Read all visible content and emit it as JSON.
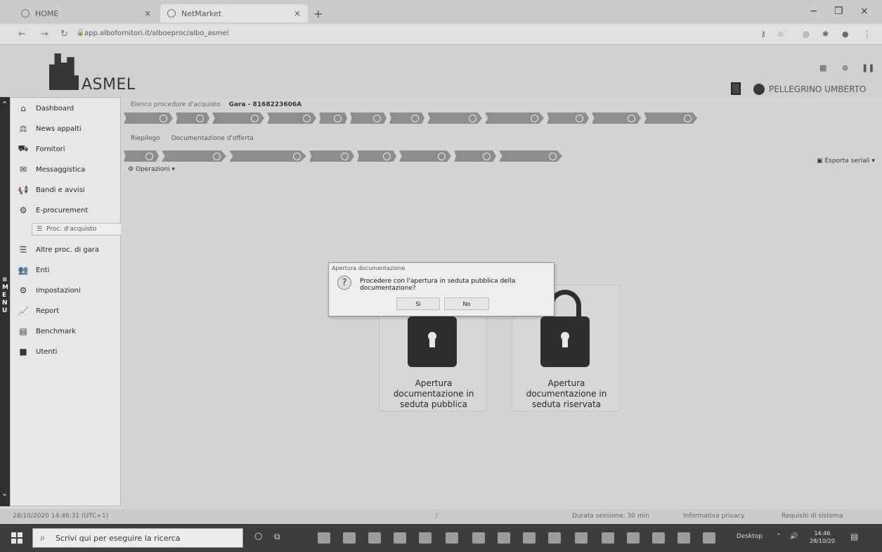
{
  "browser": {
    "tab1_title": "HOME",
    "tab2_title": "NetMarket",
    "close_glyph": "×",
    "new_tab_glyph": "+",
    "url": "app.albofornitori.it/alboeproc/albo_asmel",
    "minimize_glyph": "−",
    "maximize_glyph": "❐",
    "close_window_glyph": "×"
  },
  "header": {
    "logo_text": "ASMEL",
    "user_name": "PELLEGRINO UMBERTO"
  },
  "sidebar": {
    "items": [
      {
        "label": "Dashboard",
        "icon": "home-icon",
        "glyph": "⌂"
      },
      {
        "label": "News appalti",
        "icon": "scales-icon",
        "glyph": "⚖"
      },
      {
        "label": "Fornitori",
        "icon": "truck-icon",
        "glyph": "⛟"
      },
      {
        "label": "Messaggistica",
        "icon": "message-icon",
        "glyph": "✉"
      },
      {
        "label": "Bandi e avvisi",
        "icon": "megaphone-icon",
        "glyph": "📢"
      },
      {
        "label": "E-procurement",
        "icon": "procurement-icon",
        "glyph": "⚙"
      },
      {
        "label": "Altre proc. di gara",
        "icon": "list-icon",
        "glyph": "☰"
      },
      {
        "label": "Enti",
        "icon": "people-icon",
        "glyph": "👥"
      },
      {
        "label": "Impostazioni",
        "icon": "gear-icon",
        "glyph": "⚙"
      },
      {
        "label": "Report",
        "icon": "chart-icon",
        "glyph": "📈"
      },
      {
        "label": "Benchmark",
        "icon": "document-icon",
        "glyph": "▤"
      },
      {
        "label": "Utenti",
        "icon": "user-icon",
        "glyph": "■"
      }
    ],
    "submenu_label": "Proc. d'acquisto"
  },
  "main": {
    "breadcrumb_1": "Elenco procedure d'acquisto",
    "breadcrumb_2": "Gara - 8168223606A",
    "sub_breadcrumb_1": "Riepilogo",
    "sub_breadcrumb_2": "Documentazione d'offerta",
    "operations_label": "Operazioni",
    "export_label": "Esporta seriali",
    "cards": [
      {
        "label": "Apertura documentazione in seduta pubblica"
      },
      {
        "label": "Apertura documentazione in seduta riservata"
      }
    ]
  },
  "dialog": {
    "title": "Apertura documentazione",
    "message": "Procedere con l'apertura in seduta pubblica della documentazione?",
    "yes_label": "Sì",
    "no_label": "No",
    "icon": "question-icon"
  },
  "footer": {
    "timestamp": "28/10/2020 14:46:31 (UTC+1)",
    "session": "Durata sessione: 30 min",
    "privacy": "Informativa privacy",
    "requirements": "Requisiti di sistema"
  },
  "taskbar": {
    "search_placeholder": "Scrivi qui per eseguire la ricerca",
    "desktop_label": "Desktop",
    "time": "14:46",
    "date": "28/10/20"
  }
}
